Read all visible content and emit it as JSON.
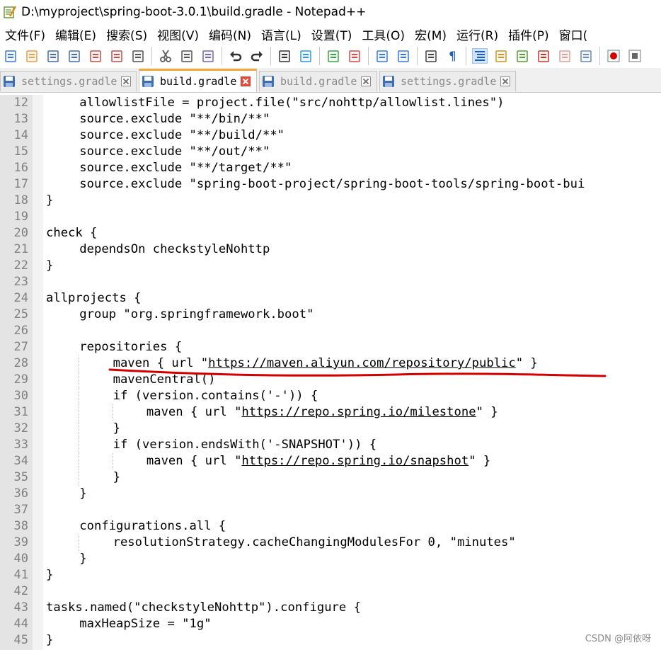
{
  "window": {
    "title": "D:\\myproject\\spring-boot-3.0.1\\build.gradle - Notepad++"
  },
  "menu": [
    "文件(F)",
    "编辑(E)",
    "搜索(S)",
    "视图(V)",
    "编码(N)",
    "语言(L)",
    "设置(T)",
    "工具(O)",
    "宏(M)",
    "运行(R)",
    "插件(P)",
    "窗口("
  ],
  "toolbar": [
    "new-file-icon",
    "open-file-icon",
    "save-icon",
    "save-all-icon",
    "close-icon",
    "close-all-icon",
    "print-icon",
    "cut-icon",
    "copy-icon",
    "paste-icon",
    "undo-icon",
    "redo-icon",
    "find-icon",
    "replace-icon",
    "zoom-in-icon",
    "zoom-out-icon",
    "sync-vertical-icon",
    "sync-horizontal-icon",
    "word-wrap-icon",
    "show-all-chars-icon",
    "indent-guide-icon",
    "udl-icon",
    "doc-map-icon",
    "function-list-icon",
    "folder-workspace-icon",
    "monitor-icon",
    "record-macro-icon",
    "stop-macro-icon"
  ],
  "tabs": [
    {
      "label": "settings.gradle",
      "active": false
    },
    {
      "label": "build.gradle",
      "active": true
    },
    {
      "label": "build.gradle",
      "active": false
    },
    {
      "label": "settings.gradle",
      "active": false
    }
  ],
  "editor": {
    "lines": [
      {
        "n": "12",
        "indent": 1,
        "text": "allowlistFile = project.file(\"src/nohttp/allowlist.lines\")"
      },
      {
        "n": "13",
        "indent": 1,
        "text": "source.exclude \"**/bin/**\""
      },
      {
        "n": "14",
        "indent": 1,
        "text": "source.exclude \"**/build/**\""
      },
      {
        "n": "15",
        "indent": 1,
        "text": "source.exclude \"**/out/**\""
      },
      {
        "n": "16",
        "indent": 1,
        "text": "source.exclude \"**/target/**\""
      },
      {
        "n": "17",
        "indent": 1,
        "text": "source.exclude \"spring-boot-project/spring-boot-tools/spring-boot-bui"
      },
      {
        "n": "18",
        "indent": 0,
        "text": "}"
      },
      {
        "n": "19",
        "indent": 0,
        "text": ""
      },
      {
        "n": "20",
        "indent": 0,
        "text": "check {"
      },
      {
        "n": "21",
        "indent": 1,
        "text": "dependsOn checkstyleNohttp"
      },
      {
        "n": "22",
        "indent": 0,
        "text": "}"
      },
      {
        "n": "23",
        "indent": 0,
        "text": ""
      },
      {
        "n": "24",
        "indent": 0,
        "text": "allprojects {"
      },
      {
        "n": "25",
        "indent": 1,
        "text": "group \"org.springframework.boot\""
      },
      {
        "n": "26",
        "indent": 0,
        "text": ""
      },
      {
        "n": "27",
        "indent": 1,
        "text": "repositories {"
      },
      {
        "n": "28",
        "indent": 2,
        "pre": "maven { url \"",
        "url": "https://maven.aliyun.com/repository/public",
        "post": "\" }"
      },
      {
        "n": "29",
        "indent": 2,
        "text": "mavenCentral()"
      },
      {
        "n": "30",
        "indent": 2,
        "text": "if (version.contains('-')) {"
      },
      {
        "n": "31",
        "indent": 3,
        "pre": "maven { url \"",
        "url": "https://repo.spring.io/milestone",
        "post": "\" }"
      },
      {
        "n": "32",
        "indent": 2,
        "text": "}"
      },
      {
        "n": "33",
        "indent": 2,
        "text": "if (version.endsWith('-SNAPSHOT')) {"
      },
      {
        "n": "34",
        "indent": 3,
        "pre": "maven { url \"",
        "url": "https://repo.spring.io/snapshot",
        "post": "\" }"
      },
      {
        "n": "35",
        "indent": 2,
        "text": "}"
      },
      {
        "n": "36",
        "indent": 1,
        "text": "}"
      },
      {
        "n": "37",
        "indent": 0,
        "text": ""
      },
      {
        "n": "38",
        "indent": 1,
        "text": "configurations.all {"
      },
      {
        "n": "39",
        "indent": 2,
        "text": "resolutionStrategy.cacheChangingModulesFor 0, \"minutes\""
      },
      {
        "n": "40",
        "indent": 1,
        "text": "}"
      },
      {
        "n": "41",
        "indent": 0,
        "text": "}"
      },
      {
        "n": "42",
        "indent": 0,
        "text": ""
      },
      {
        "n": "43",
        "indent": 0,
        "text": "tasks.named(\"checkstyleNohttp\").configure {"
      },
      {
        "n": "44",
        "indent": 1,
        "text": "maxHeapSize = \"1g\""
      },
      {
        "n": "45",
        "indent": 0,
        "text": "}"
      }
    ]
  },
  "watermark": "CSDN @阿依呀",
  "annotation_color": "#d40000"
}
